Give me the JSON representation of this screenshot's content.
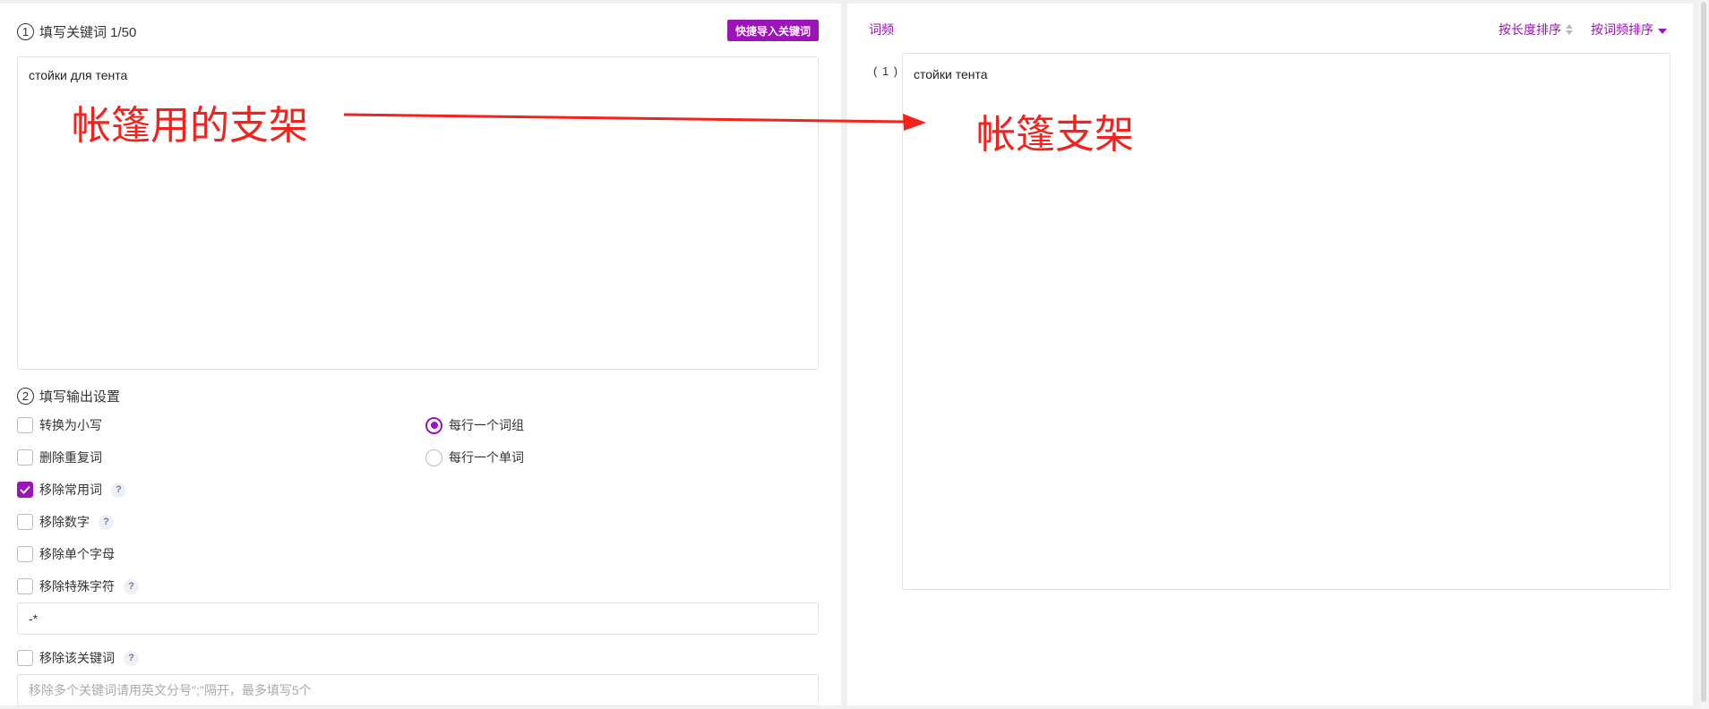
{
  "input_section": {
    "step_number": "1",
    "title": "填写关键词 1/50",
    "import_button": "快捷导入关键词",
    "keyword_text": "стойки для тента"
  },
  "output_settings": {
    "step_number": "2",
    "title": "填写输出设置",
    "options": {
      "lowercase": {
        "label": "转换为小写",
        "checked": false
      },
      "remove_duplicates": {
        "label": "删除重复词",
        "checked": false
      },
      "remove_common": {
        "label": "移除常用词",
        "checked": true
      },
      "remove_numbers": {
        "label": "移除数字",
        "checked": false
      },
      "remove_single_letters": {
        "label": "移除单个字母",
        "checked": false
      },
      "remove_special_chars": {
        "label": "移除特殊字符",
        "checked": false
      },
      "remove_keyword": {
        "label": "移除该关键词",
        "checked": false
      }
    },
    "special_chars_value": "-*",
    "remove_keyword_placeholder": "移除多个关键词请用英文分号\";\"隔开，最多填写5个",
    "per_line_group": {
      "label": "每行一个词组",
      "selected": true
    },
    "per_line_word": {
      "label": "每行一个单词",
      "selected": false
    },
    "help_glyph": "?"
  },
  "results": {
    "tab_label": "词频",
    "sort_by_length": "按长度排序",
    "sort_by_frequency": "按词频排序",
    "items": [
      {
        "index": "( 1 )",
        "text": "стойки тента"
      }
    ]
  },
  "annotations": {
    "left_note": "帐篷用的支架",
    "right_note": "帐篷支架",
    "color": "#f2221d"
  },
  "colors": {
    "accent": "#9a14b8",
    "border": "#e2e2e2",
    "background": "#f0f0f2"
  }
}
